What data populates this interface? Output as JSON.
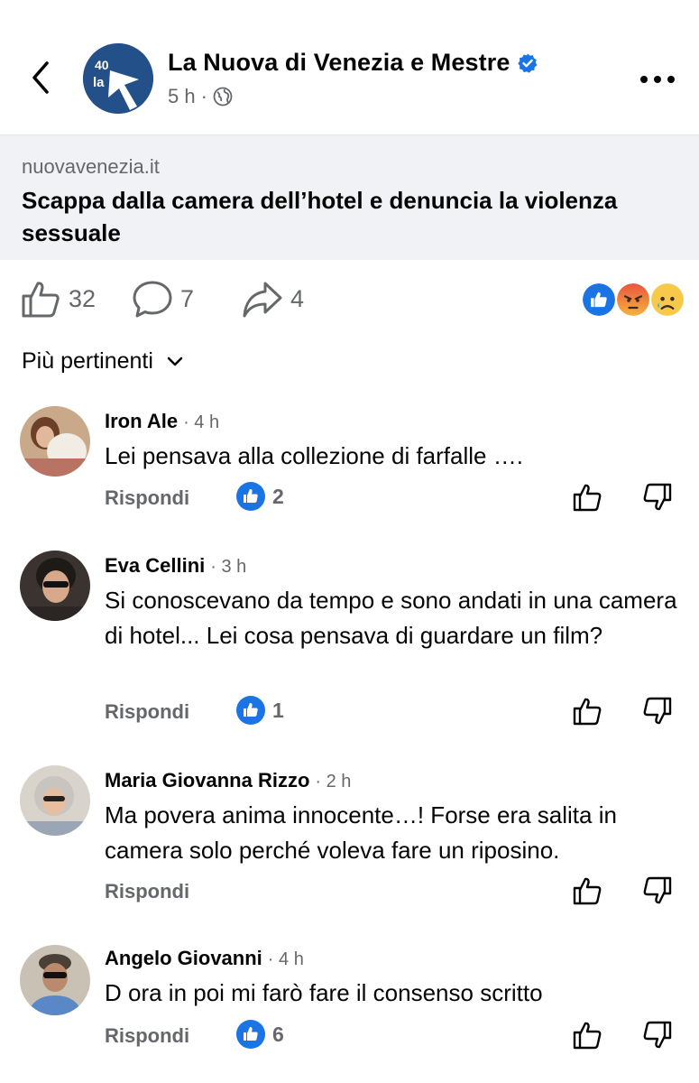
{
  "post": {
    "page_name": "La Nuova di Venezia e Mestre",
    "time": "5 h",
    "meta_dot": "·",
    "avatar_text_40": "40",
    "avatar_text_la": "la",
    "link_domain": "nuovavenezia.it",
    "link_title": "Scappa dalla camera dell’hotel e denuncia la violenza sessuale",
    "likes": "32",
    "comments": "7",
    "shares": "4"
  },
  "sort_label": "Più pertinenti",
  "reply_label": "Rispondi",
  "colors": {
    "accent": "#1b74e4",
    "muted": "#65676b",
    "card_bg": "#f0f2f5"
  },
  "comments": [
    {
      "name": "Iron Ale",
      "time": "· 4 h",
      "text": "Lei pensava alla collezione di farfalle ….",
      "likes": "2"
    },
    {
      "name": "Eva Cellini",
      "time": "· 3 h",
      "text": "Si conoscevano da tempo e sono andati in una camera di hotel... Lei cosa pensava di guardare un film?",
      "likes": "1"
    },
    {
      "name": "Maria Giovanna Rizzo",
      "time": "· 2 h",
      "text": "Ma povera anima innocente…! Forse era salita in camera solo perché voleva fare un riposino.",
      "likes": ""
    },
    {
      "name": "Angelo Giovanni",
      "time": "· 4 h",
      "text": "D ora in poi mi farò fare il consenso scritto",
      "likes": "6"
    }
  ]
}
